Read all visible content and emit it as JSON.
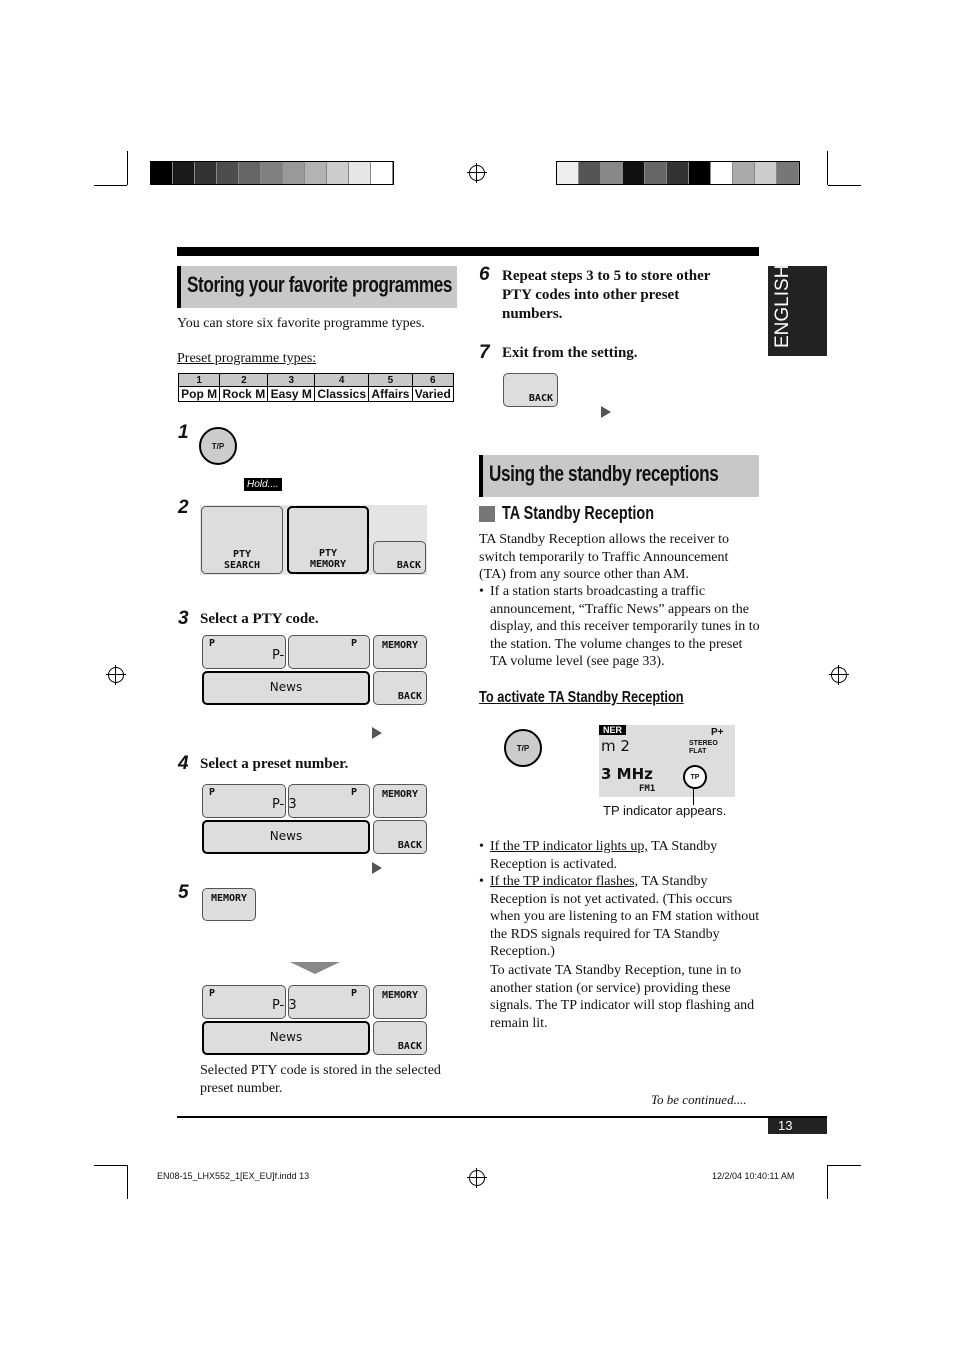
{
  "colors": {
    "bar_left": [
      "#000000",
      "#1a1a1a",
      "#333333",
      "#4d4d4d",
      "#666666",
      "#808080",
      "#999999",
      "#b3b3b3",
      "#cccccc",
      "#e6e6e6",
      "#ffffff"
    ],
    "bar_right": [
      "#eeeeee",
      "#555555",
      "#888888",
      "#111111",
      "#666666",
      "#333333",
      "#000000",
      "#ffffff",
      "#aaaaaa",
      "#cccccc",
      "#777777"
    ],
    "heading_bg": "#c8c8c8",
    "tab_bg": "#222222"
  },
  "language_tab": "ENGLISH",
  "left": {
    "title": "Storing your favorite programmes",
    "intro": "You can store six favorite programme types.",
    "preset_label": "Preset programme types:",
    "preset_table": {
      "numbers": [
        "1",
        "2",
        "3",
        "4",
        "5",
        "6"
      ],
      "types": [
        "Pop M",
        "Rock M",
        "Easy M",
        "Classics",
        "Affairs",
        "Varied"
      ]
    },
    "step1": {
      "num": "1",
      "button": "T/P",
      "hold": "Hold...."
    },
    "step2": {
      "num": "2",
      "btn1": "PTY SEARCH",
      "btn2": "PTY MEMORY",
      "back": "BACK"
    },
    "step3": {
      "num": "3",
      "text": "Select a PTY code.",
      "p_left": "P",
      "p_right": "P",
      "display": "P-",
      "pty": "News",
      "memory": "MEMORY",
      "back": "BACK"
    },
    "step4": {
      "num": "4",
      "text": "Select a preset number.",
      "p_left": "P",
      "p_right": "P",
      "display": "P- 3",
      "pty": "News",
      "memory": "MEMORY",
      "back": "BACK"
    },
    "step5": {
      "num": "5",
      "memory": "MEMORY",
      "p_left": "P",
      "p_right": "P",
      "display": "P- 3",
      "pty": "News",
      "memory2": "MEMORY",
      "back": "BACK",
      "caption": "Selected PTY code is stored in the selected preset number."
    }
  },
  "right": {
    "step6": {
      "num": "6",
      "text": "Repeat steps 3 to 5 to store other PTY codes into other preset numbers."
    },
    "step7": {
      "num": "7",
      "text": "Exit from the setting.",
      "back": "BACK"
    },
    "title": "Using the standby receptions",
    "subtitle": "TA Standby Reception",
    "desc": "TA Standby Reception allows the receiver to switch temporarily to Traffic Announcement (TA) from any source other than AM.",
    "bullet1": "If a station starts broadcasting a traffic announcement, “Traffic News” appears on the display, and this receiver temporarily tunes in to the station. The volume changes to the preset TA volume level (see page 33).",
    "activate_heading": "To activate TA Standby Reception",
    "tp_button": "T/P",
    "display": {
      "tuner": "NER",
      "line1": "m 2",
      "line2": "3  MHz",
      "band": "FM1",
      "pplus": "P+",
      "stereo": "STEREO",
      "flat": "FLAT",
      "tp": "TP"
    },
    "tp_caption": "TP indicator appears.",
    "bullet2_link": "If the TP indicator lights up,",
    "bullet2_rest": " TA Standby Reception is activated.",
    "bullet3_link": "If the TP indicator flashes,",
    "bullet3_rest": " TA Standby Reception is not yet activated. (This occurs when you are listening to an FM station without the RDS signals required for TA Standby Reception.)",
    "bullet3_extra": "To activate TA Standby Reception, tune in to another station (or service) providing these signals. The TP indicator will stop flashing and remain lit.",
    "continued": "To be continued...."
  },
  "page_number": "13",
  "footer": {
    "file": "EN08-15_LHX552_1[EX_EU]f.indd   13",
    "date": "12/2/04   10:40:11 AM"
  }
}
